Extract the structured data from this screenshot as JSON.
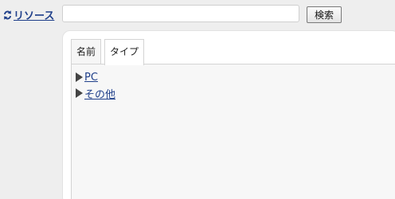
{
  "header": {
    "resource_label": "リソース",
    "reload_icon": "reload-icon",
    "search": {
      "value": "",
      "placeholder": ""
    },
    "search_button_label": "検索"
  },
  "panel": {
    "tabs": [
      {
        "label": "名前"
      },
      {
        "label": "タイプ"
      }
    ],
    "active_tab": "タイプ",
    "tree": [
      {
        "label": "PC",
        "expanded": false
      },
      {
        "label": "その他",
        "expanded": false
      }
    ]
  },
  "colors": {
    "link": "#1f3f8a",
    "background": "#eeeeee",
    "panel": "#ffffff",
    "tab_content": "#f7f7f7"
  }
}
